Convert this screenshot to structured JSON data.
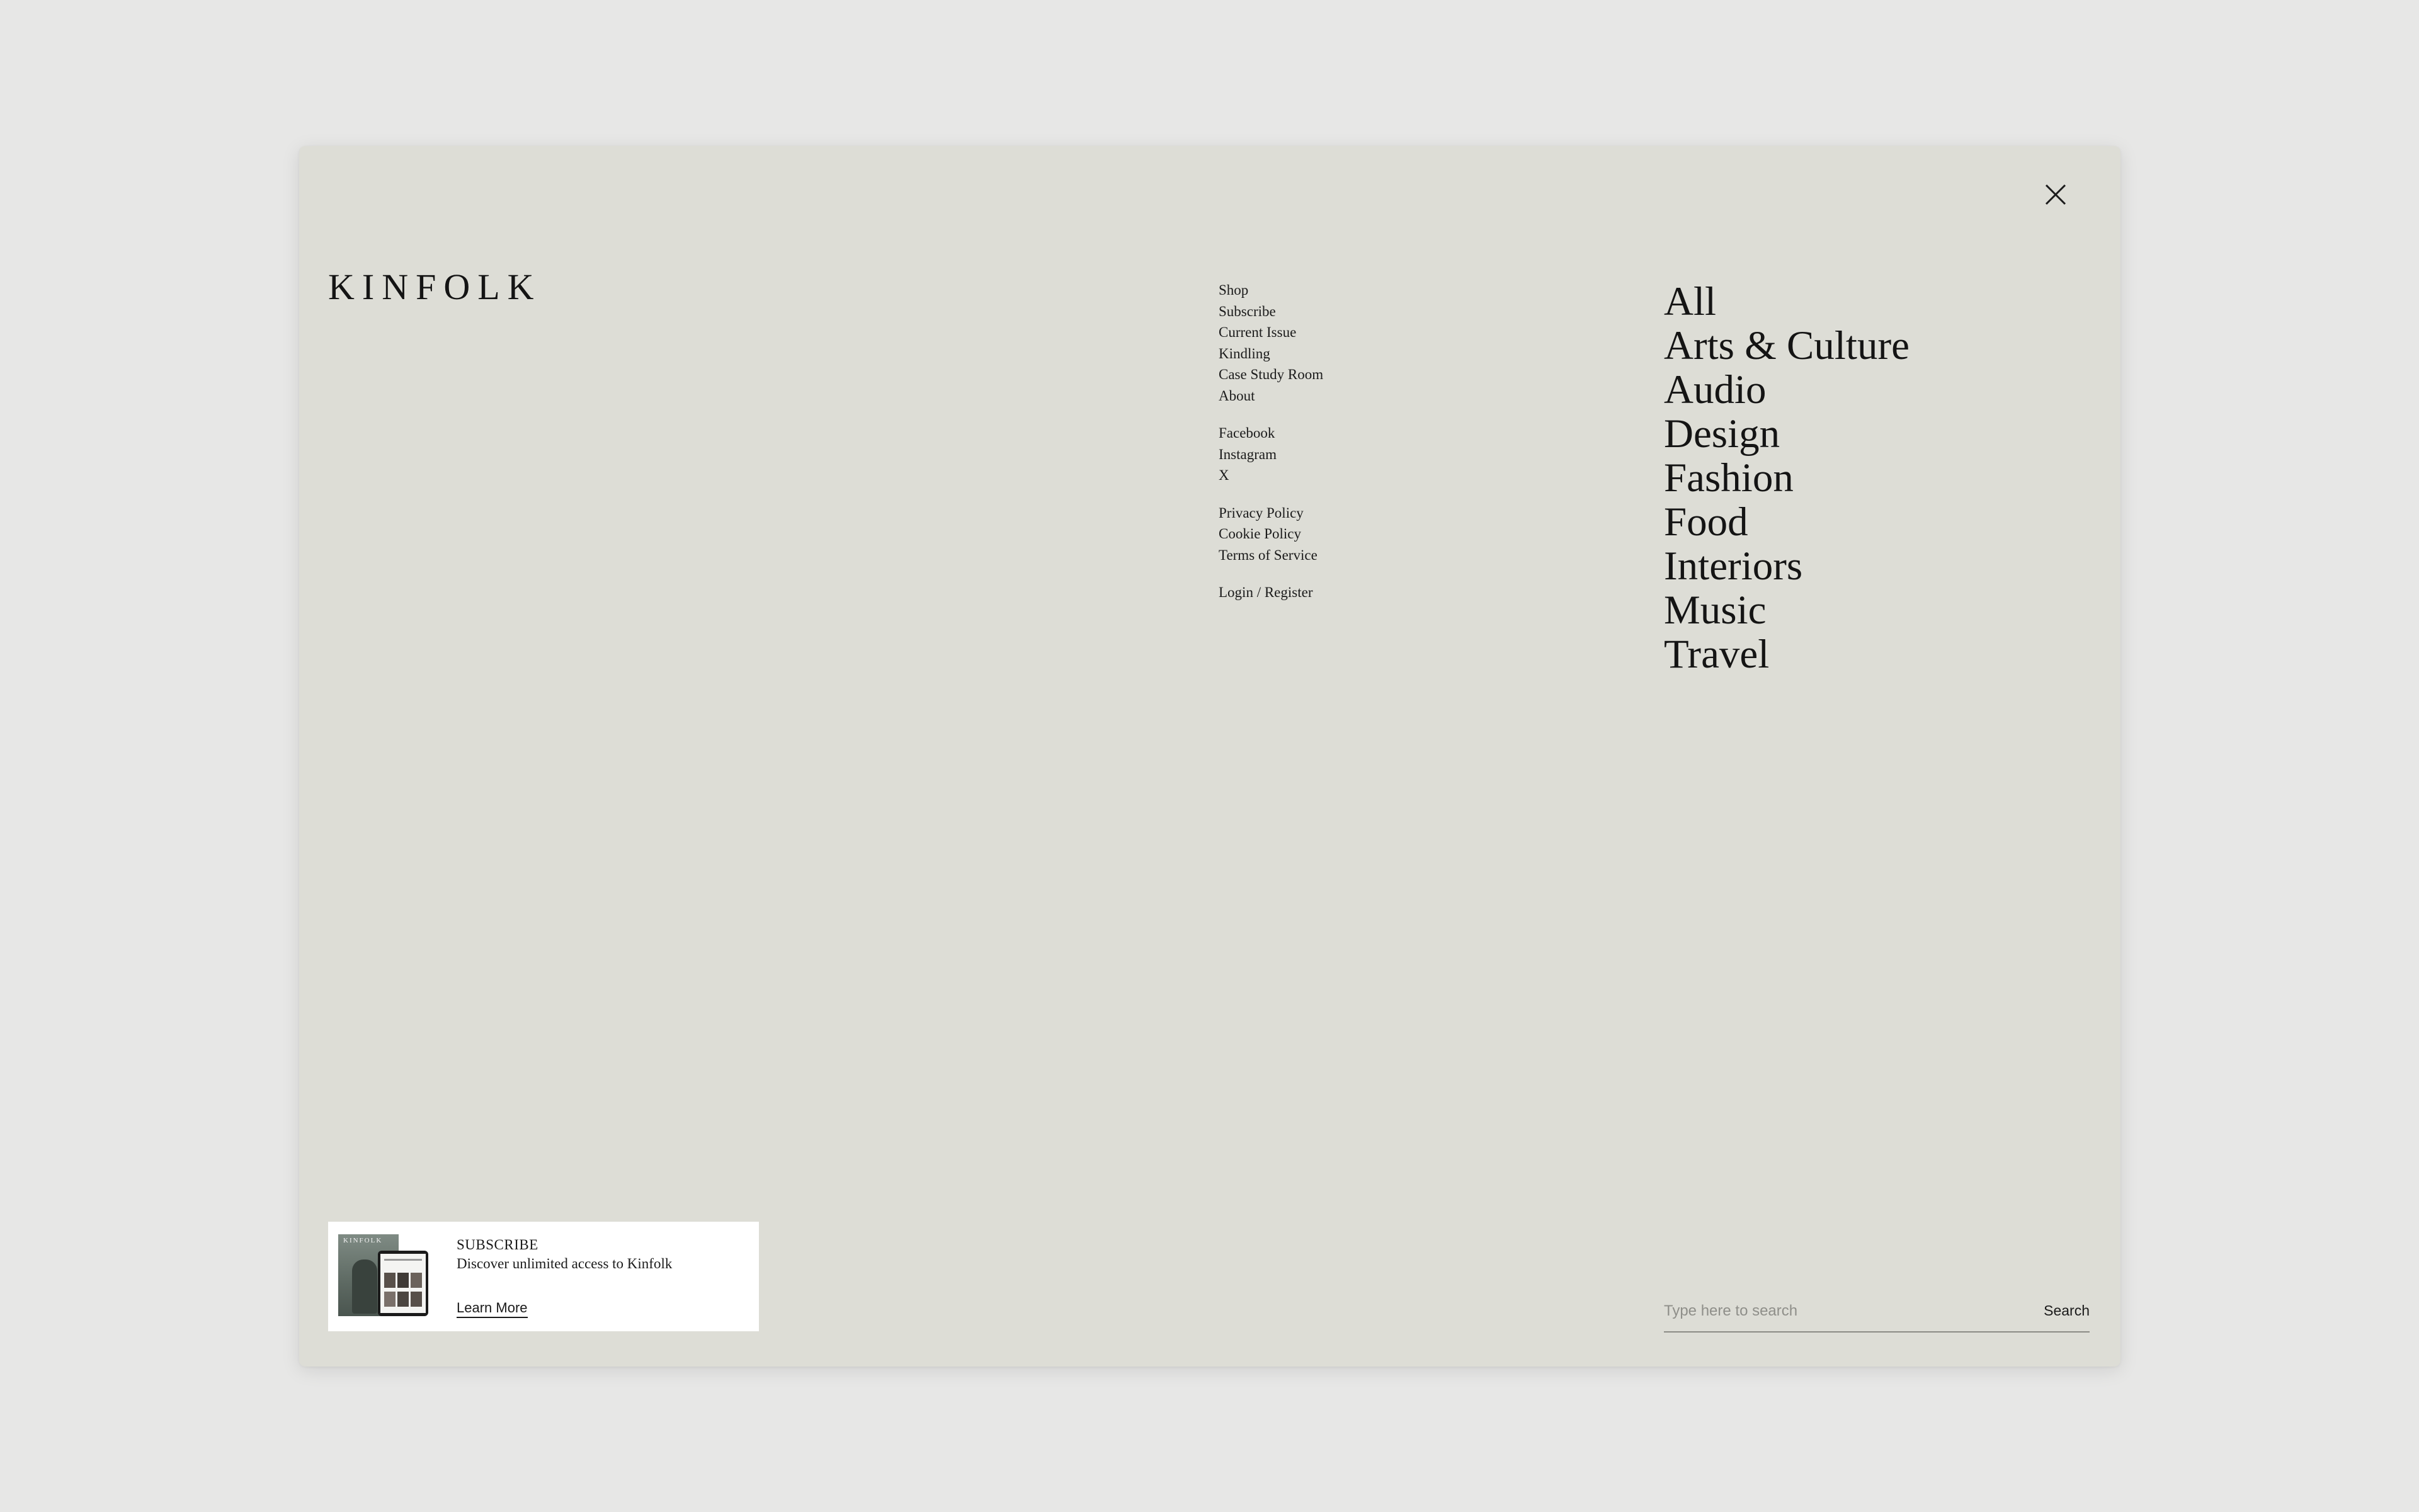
{
  "brand": {
    "logo": "KINFOLK"
  },
  "menu": {
    "main": [
      "Shop",
      "Subscribe",
      "Current Issue",
      "Kindling",
      "Case Study Room",
      "About"
    ],
    "social": [
      "Facebook",
      "Instagram",
      "X"
    ],
    "legal": [
      "Privacy Policy",
      "Cookie Policy",
      "Terms of Service"
    ],
    "account": "Login / Register"
  },
  "categories": [
    "All",
    "Arts & Culture",
    "Audio",
    "Design",
    "Fashion",
    "Food",
    "Interiors",
    "Music",
    "Travel"
  ],
  "promo": {
    "title": "SUBSCRIBE",
    "description": "Discover unlimited access to Kinfolk",
    "link": "Learn More",
    "thumbnail_logo": "KINFOLK"
  },
  "search": {
    "placeholder": "Type here to search",
    "button": "Search"
  },
  "icons": {
    "close": "close-icon"
  }
}
